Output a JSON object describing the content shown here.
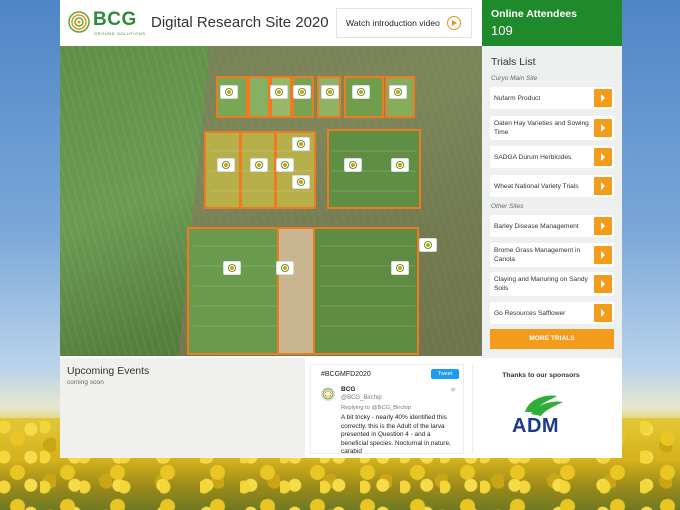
{
  "brand": {
    "logo_text": "BCG",
    "logo_tagline": "GROUND SOLUTIONS"
  },
  "header": {
    "title": "Digital Research Site 2020",
    "video_button": "Watch introduction video"
  },
  "attendees": {
    "label": "Online Attendees",
    "count": "109"
  },
  "trials": {
    "title": "Trials List",
    "main_site_label": "Curyo Main Site",
    "main_site_items": [
      {
        "label": "Nufarm Product"
      },
      {
        "label": "Oaten Hay Varieties and Sowing Time"
      },
      {
        "label": "SADGA Durum Herbicides"
      },
      {
        "label": "Wheat National Variety Trials"
      }
    ],
    "other_sites_label": "Other Sites",
    "other_site_items": [
      {
        "label": "Barley Disease Management"
      },
      {
        "label": "Brome Grass Management in Canola"
      },
      {
        "label": "Claying and Manuring on Sandy Soils"
      },
      {
        "label": "Go Resources Safflower"
      }
    ],
    "more_button": "MORE TRIALS"
  },
  "events": {
    "title": "Upcoming Events",
    "subtitle": "coming soon"
  },
  "twitter": {
    "hashtag": "#BCGMFD2020",
    "tweet_button": "Tweet",
    "account_name": "BCG",
    "handle": "@BCG_Birchip",
    "reply_to": "Replying to @BCG_Birchip",
    "text": "A bit tricky - nearly 40% identified this correctly. this is the Adult of the larva presented in Question 4 - and a beneficial species. Nocturnal in nature, carabid"
  },
  "sponsors": {
    "title": "Thanks to our sponsors",
    "sponsor_name": "ADM"
  },
  "colors": {
    "brand_green": "#1f8a2c",
    "accent_orange": "#f39b1a",
    "adm_blue": "#1a3a8c"
  }
}
